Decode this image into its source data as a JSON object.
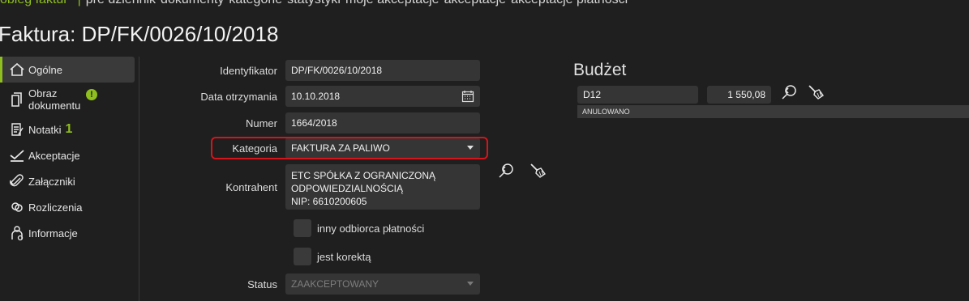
{
  "topnav": {
    "items": [
      "obieg faktur",
      "pre dziennik",
      "dokumenty",
      "kategorie",
      "statystyki",
      "moje akceptacje",
      "akceptacje",
      "akceptacje płatności"
    ]
  },
  "page_title": "Faktura: DP/FK/0026/10/2018",
  "sidebar": {
    "items": [
      {
        "label": "Ogólne",
        "icon": "home-icon"
      },
      {
        "label": "Obraz dokumentu",
        "icon": "document-icon",
        "badge": "!"
      },
      {
        "label": "Notatki",
        "icon": "notes-icon",
        "badge": "1"
      },
      {
        "label": "Akceptacje",
        "icon": "checkmark-icon"
      },
      {
        "label": "Załączniki",
        "icon": "paperclip-icon"
      },
      {
        "label": "Rozliczenia",
        "icon": "settlement-icon"
      },
      {
        "label": "Informacje",
        "icon": "info-icon"
      }
    ]
  },
  "form": {
    "identyfikator": {
      "label": "Identyfikator",
      "value": "DP/FK/0026/10/2018"
    },
    "data_otrzymania": {
      "label": "Data otrzymania",
      "value": "10.10.2018"
    },
    "numer": {
      "label": "Numer",
      "value": "1664/2018"
    },
    "kategoria": {
      "label": "Kategoria",
      "value": "FAKTURA ZA PALIWO"
    },
    "kontrahent": {
      "label": "Kontrahent",
      "line1": "ETC SPÓŁKA Z OGRANICZONĄ",
      "line2": "ODPOWIEDZIALNOŚCIĄ",
      "line3": "NIP: 6610200605"
    },
    "inny_odbiorca": {
      "label": "inny odbiorca płatności",
      "checked": false
    },
    "jest_korekta": {
      "label": "jest korektą",
      "checked": false
    },
    "status": {
      "label": "Status",
      "value": "ZAAKCEPTOWANY"
    }
  },
  "budget": {
    "title": "Budżet",
    "code": "D12",
    "amount": "1 550,08",
    "status": "ANULOWANO"
  },
  "colors": {
    "accent": "#8fbf1f",
    "highlight": "#d6141b",
    "background": "#1f1f1f"
  }
}
